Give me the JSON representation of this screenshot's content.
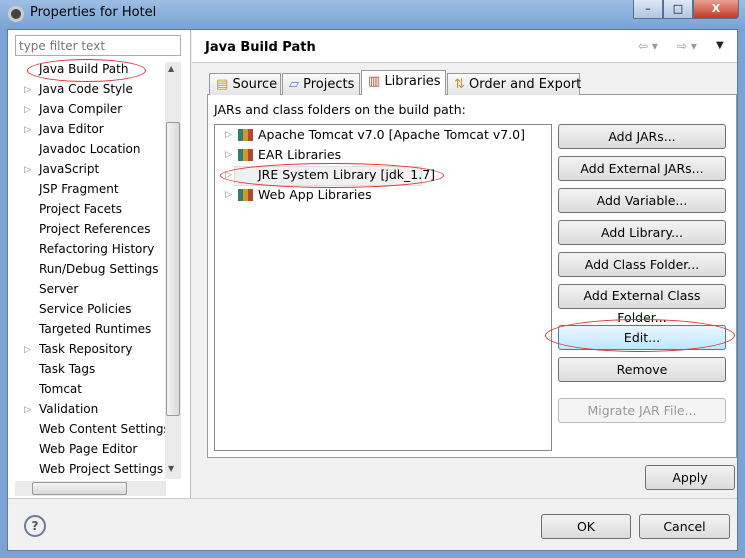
{
  "window": {
    "title": "Properties for Hotel",
    "minimize": "–",
    "maximize": "□",
    "close": "X"
  },
  "filter": {
    "placeholder": "type filter text"
  },
  "sidebar": {
    "items": [
      {
        "label": "Java Build Path",
        "expandable": false,
        "selected": true
      },
      {
        "label": "Java Code Style",
        "expandable": true
      },
      {
        "label": "Java Compiler",
        "expandable": true
      },
      {
        "label": "Java Editor",
        "expandable": true
      },
      {
        "label": "Javadoc Location",
        "expandable": false
      },
      {
        "label": "JavaScript",
        "expandable": true
      },
      {
        "label": "JSP Fragment",
        "expandable": false
      },
      {
        "label": "Project Facets",
        "expandable": false
      },
      {
        "label": "Project References",
        "expandable": false
      },
      {
        "label": "Refactoring History",
        "expandable": false
      },
      {
        "label": "Run/Debug Settings",
        "expandable": false
      },
      {
        "label": "Server",
        "expandable": false
      },
      {
        "label": "Service Policies",
        "expandable": false
      },
      {
        "label": "Targeted Runtimes",
        "expandable": false
      },
      {
        "label": "Task Repository",
        "expandable": true
      },
      {
        "label": "Task Tags",
        "expandable": false
      },
      {
        "label": "Tomcat",
        "expandable": false
      },
      {
        "label": "Validation",
        "expandable": true
      },
      {
        "label": "Web Content Settings",
        "expandable": false
      },
      {
        "label": "Web Page Editor",
        "expandable": false
      },
      {
        "label": "Web Project Settings",
        "expandable": false
      }
    ]
  },
  "page": {
    "title": "Java Build Path",
    "nav": {
      "back": "⇦ ▾",
      "forward": "⇨ ▾",
      "menu": "▼"
    }
  },
  "tabs": [
    {
      "label": "Source",
      "icon": "source-folder-icon"
    },
    {
      "label": "Projects",
      "icon": "folder-icon"
    },
    {
      "label": "Libraries",
      "icon": "library-icon",
      "selected": true
    },
    {
      "label": "Order and Export",
      "icon": "order-icon"
    }
  ],
  "libraries": {
    "caption": "JARs and class folders on the build path:",
    "entries": [
      "Apache Tomcat v7.0 [Apache Tomcat v7.0]",
      "EAR Libraries",
      "JRE System Library [jdk_1.7]",
      "Web App Libraries"
    ]
  },
  "buttons": {
    "add_jars": "Add JARs...",
    "add_external_jars": "Add External JARs...",
    "add_variable": "Add Variable...",
    "add_library": "Add Library...",
    "add_class_folder": "Add Class Folder...",
    "add_external_class_folder": "Add External Class Folder...",
    "edit": "Edit...",
    "remove": "Remove",
    "migrate": "Migrate JAR File...",
    "apply": "Apply",
    "ok": "OK",
    "cancel": "Cancel",
    "help": "?"
  },
  "colors": {
    "annotation": "#e03030",
    "frame": "#7ba3d4"
  }
}
